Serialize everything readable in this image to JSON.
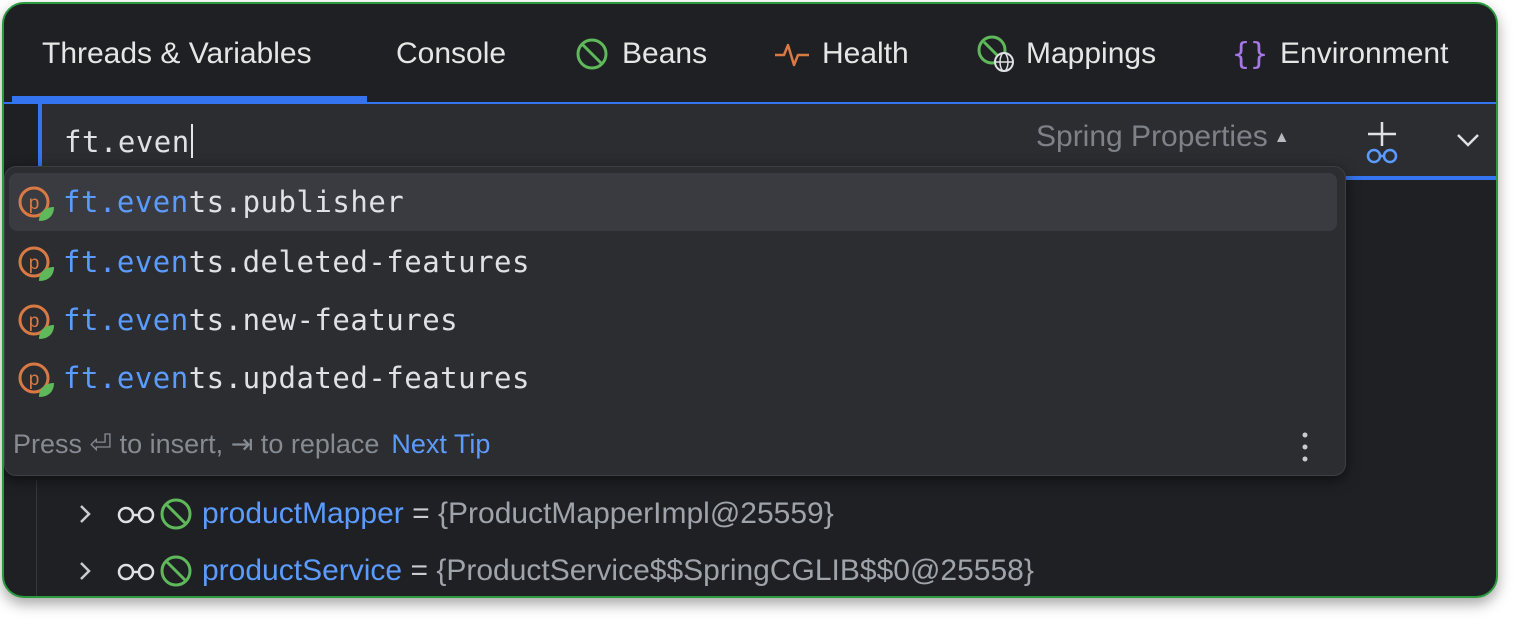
{
  "tabs": [
    {
      "label": "Threads & Variables",
      "icon": "",
      "active": true
    },
    {
      "label": "Console",
      "icon": ""
    },
    {
      "label": "Beans",
      "icon": "bean-icon"
    },
    {
      "label": "Health",
      "icon": "heartbeat-icon"
    },
    {
      "label": "Mappings",
      "icon": "mappings-icon"
    },
    {
      "label": "Environment",
      "icon": "braces-icon"
    }
  ],
  "search": {
    "value": "ft.even",
    "scope_label": "Spring Properties"
  },
  "completion": {
    "items": [
      {
        "match": "ft.even",
        "rest": "ts.publisher",
        "icon": "spring-property-icon",
        "selected": true
      },
      {
        "match": "ft.even",
        "rest": "ts.deleted-features",
        "icon": "spring-property-icon"
      },
      {
        "match": "ft.even",
        "rest": "ts.new-features",
        "icon": "spring-property-icon"
      },
      {
        "match": "ft.even",
        "rest": "ts.updated-features",
        "icon": "spring-property-icon"
      }
    ],
    "footer": {
      "text": "Press ⏎ to insert, ⇥ to replace",
      "tip_link": "Next Tip"
    }
  },
  "variables": [
    {
      "name": "productMapper",
      "eq": "=",
      "value": "{ProductMapperImpl@25559}"
    },
    {
      "name": "productService",
      "eq": "=",
      "value": "{ProductService$$SpringCGLIB$$0@25558}"
    }
  ],
  "colors": {
    "accent": "#3574f0",
    "match_text": "#5b9bff",
    "background": "#1f2024",
    "popup": "#2b2d30",
    "frame_border": "#2a9a3c",
    "spring_orange": "#d97a45",
    "spring_green": "#5fb85a"
  }
}
